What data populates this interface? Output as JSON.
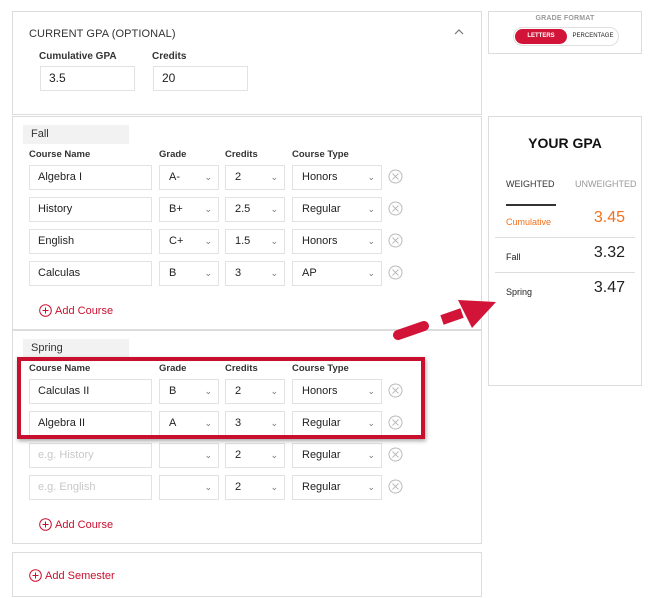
{
  "current_gpa": {
    "title": "CURRENT GPA (OPTIONAL)",
    "collapse_icon": "chevron-up-icon",
    "cumulative_label": "Cumulative GPA",
    "cumulative_value": "3.5",
    "credits_label": "Credits",
    "credits_value": "20"
  },
  "columns": {
    "course_name": "Course Name",
    "grade": "Grade",
    "credits": "Credits",
    "course_type": "Course Type"
  },
  "semesters": [
    {
      "name": "Fall",
      "courses": [
        {
          "name": "Algebra I",
          "placeholder": "",
          "grade": "A-",
          "credits": "2",
          "type": "Honors"
        },
        {
          "name": "History",
          "placeholder": "",
          "grade": "B+",
          "credits": "2.5",
          "type": "Regular"
        },
        {
          "name": "English",
          "placeholder": "",
          "grade": "C+",
          "credits": "1.5",
          "type": "Honors"
        },
        {
          "name": "Calculas",
          "placeholder": "",
          "grade": "B",
          "credits": "3",
          "type": "AP"
        }
      ],
      "add_course_label": "Add Course"
    },
    {
      "name": "Spring",
      "courses": [
        {
          "name": "Calculas II",
          "placeholder": "",
          "grade": "B",
          "credits": "2",
          "type": "Honors"
        },
        {
          "name": "Algebra II",
          "placeholder": "",
          "grade": "A",
          "credits": "3",
          "type": "Regular"
        },
        {
          "name": "",
          "placeholder": "e.g. History",
          "grade": "",
          "credits": "2",
          "type": "Regular"
        },
        {
          "name": "",
          "placeholder": "e.g. English",
          "grade": "",
          "credits": "2",
          "type": "Regular"
        }
      ],
      "add_course_label": "Add Course"
    }
  ],
  "add_semester_label": "Add Semester",
  "grade_format": {
    "title": "GRADE FORMAT",
    "options": [
      "LETTERS",
      "PERCENTAGE"
    ],
    "selected": "LETTERS"
  },
  "your_gpa": {
    "title": "YOUR GPA",
    "tabs": [
      "WEIGHTED",
      "UNWEIGHTED"
    ],
    "active_tab": "WEIGHTED",
    "rows": [
      {
        "label": "Cumulative",
        "value": "3.45"
      },
      {
        "label": "Fall",
        "value": "3.32"
      },
      {
        "label": "Spring",
        "value": "3.47"
      }
    ]
  },
  "colors": {
    "accent": "#c8102e",
    "toggle_active": "#d11437",
    "cumulative": "#f2711c"
  },
  "annotations": {
    "highlight_box": "spring-courses-highlight",
    "arrow": "arrow-to-spring-gpa"
  }
}
